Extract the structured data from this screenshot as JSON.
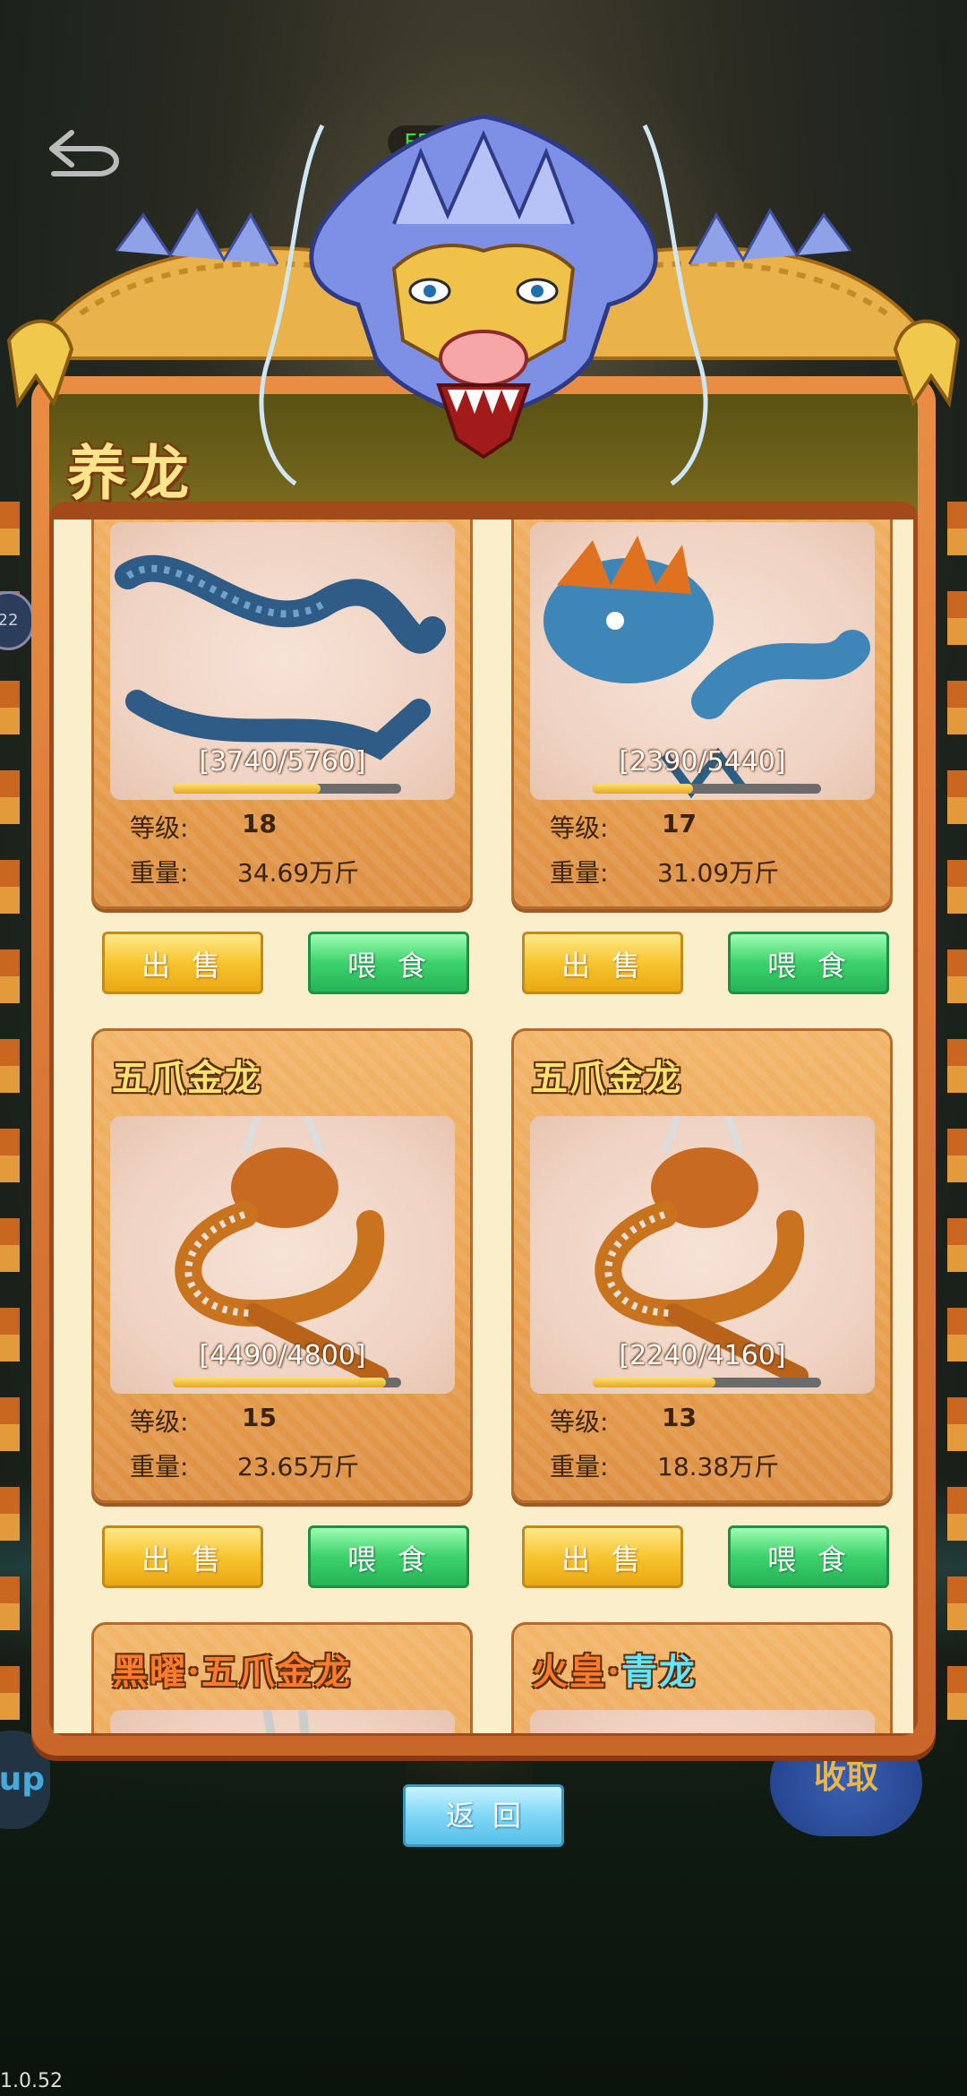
{
  "hud": {
    "fps": "FPS62",
    "version": "1.0.52",
    "side_badge": "22",
    "side_up": "up",
    "side_claim": "收取"
  },
  "panel": {
    "title": "养龙"
  },
  "labels": {
    "level": "等级:",
    "weight": "重量:",
    "sell": "出售",
    "feed": "喂食",
    "return": "返回"
  },
  "dragons": [
    {
      "name": "",
      "progress": "[3740/5760]",
      "progress_ratio": 0.649,
      "level": "18",
      "weight": "34.69万斤",
      "color": "#3a6fa0"
    },
    {
      "name": "",
      "progress": "[2390/5440]",
      "progress_ratio": 0.439,
      "level": "17",
      "weight": "31.09万斤",
      "color": "#3f86b8"
    },
    {
      "name": "五爪金龙",
      "progress": "[4490/4800]",
      "progress_ratio": 0.935,
      "level": "15",
      "weight": "23.65万斤",
      "color": "#c9731e"
    },
    {
      "name": "五爪金龙",
      "progress": "[2240/4160]",
      "progress_ratio": 0.538,
      "level": "13",
      "weight": "18.38万斤",
      "color": "#c9731e"
    },
    {
      "name": "黑曜·五爪金龙",
      "color": "#5a5a5a"
    },
    {
      "name_part1": "火皇·",
      "name_part2": "青龙",
      "color": "#c2555a"
    }
  ]
}
